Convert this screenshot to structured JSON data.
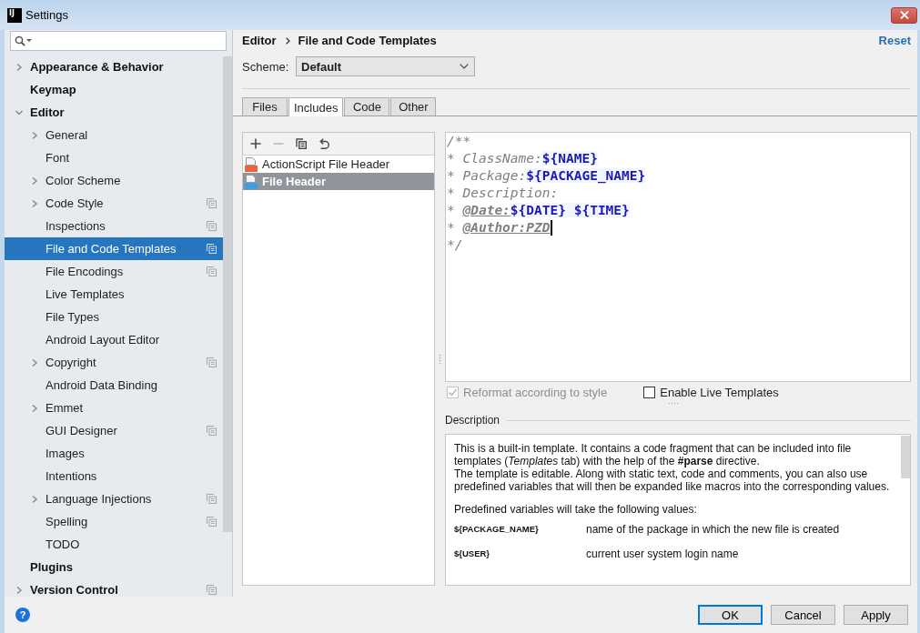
{
  "window": {
    "logo": "IJ",
    "title": "Settings"
  },
  "sidebar": {
    "items": [
      {
        "label": "Appearance & Behavior",
        "expanded": false,
        "selected": false,
        "project_level": false
      },
      {
        "label": "Keymap",
        "selected": false,
        "project_level": false
      },
      {
        "label": "Editor",
        "expanded": true,
        "selected": false,
        "project_level": false,
        "children": [
          {
            "label": "General",
            "expanded": false,
            "selected": false,
            "project_level": false
          },
          {
            "label": "Font",
            "selected": false,
            "project_level": false
          },
          {
            "label": "Color Scheme",
            "expanded": false,
            "selected": false,
            "project_level": false
          },
          {
            "label": "Code Style",
            "expanded": false,
            "selected": false,
            "project_level": true
          },
          {
            "label": "Inspections",
            "selected": false,
            "project_level": true
          },
          {
            "label": "File and Code Templates",
            "selected": true,
            "project_level": true
          },
          {
            "label": "File Encodings",
            "selected": false,
            "project_level": true
          },
          {
            "label": "Live Templates",
            "selected": false,
            "project_level": false
          },
          {
            "label": "File Types",
            "selected": false,
            "project_level": false
          },
          {
            "label": "Android Layout Editor",
            "selected": false,
            "project_level": false
          },
          {
            "label": "Copyright",
            "expanded": false,
            "selected": false,
            "project_level": true
          },
          {
            "label": "Android Data Binding",
            "selected": false,
            "project_level": false
          },
          {
            "label": "Emmet",
            "expanded": false,
            "selected": false,
            "project_level": false
          },
          {
            "label": "GUI Designer",
            "selected": false,
            "project_level": true
          },
          {
            "label": "Images",
            "selected": false,
            "project_level": false
          },
          {
            "label": "Intentions",
            "selected": false,
            "project_level": false
          },
          {
            "label": "Language Injections",
            "expanded": false,
            "selected": false,
            "project_level": true
          },
          {
            "label": "Spelling",
            "selected": false,
            "project_level": true
          },
          {
            "label": "TODO",
            "selected": false,
            "project_level": false
          }
        ]
      },
      {
        "label": "Plugins",
        "selected": false,
        "project_level": false
      },
      {
        "label": "Version Control",
        "expanded": false,
        "selected": false,
        "project_level": true
      }
    ]
  },
  "breadcrumb": [
    "Editor",
    "File and Code Templates"
  ],
  "reset_link": "Reset",
  "scheme": {
    "label": "Scheme:",
    "value": "Default"
  },
  "tabs": [
    {
      "label": "Files",
      "selected": false
    },
    {
      "label": "Includes",
      "selected": true
    },
    {
      "label": "Code",
      "selected": false
    },
    {
      "label": "Other",
      "selected": false
    }
  ],
  "template_list": {
    "toolbar": [
      {
        "kind": "add",
        "disabled": false
      },
      {
        "kind": "remove",
        "disabled": true
      },
      {
        "kind": "copy",
        "disabled": false
      },
      {
        "kind": "reset",
        "disabled": false
      }
    ],
    "items": [
      {
        "kind": "actionscript",
        "label": "ActionScript File Header",
        "selected": false
      },
      {
        "kind": "java",
        "label": "File Header",
        "selected": true
      }
    ]
  },
  "editor": {
    "lines": [
      [
        {
          "kind": "comment",
          "text": "/**"
        }
      ],
      [
        {
          "kind": "comment",
          "text": "* ClassName:"
        },
        {
          "kind": "variable",
          "text": "${NAME}"
        }
      ],
      [
        {
          "kind": "comment",
          "text": "* Package:"
        },
        {
          "kind": "variable",
          "text": "${PACKAGE_NAME}"
        }
      ],
      [
        {
          "kind": "comment",
          "text": "* Description:"
        }
      ],
      [
        {
          "kind": "comment",
          "text": "* "
        },
        {
          "kind": "tag",
          "text": "@Date:"
        },
        {
          "kind": "variable",
          "text": "${DATE} ${TIME}"
        }
      ],
      [
        {
          "kind": "comment",
          "text": "* "
        },
        {
          "kind": "tag",
          "text": "@Author:PZD"
        },
        {
          "kind": "caret"
        }
      ],
      [
        {
          "kind": "comment",
          "text": "*/"
        }
      ]
    ]
  },
  "options": [
    {
      "label": "Reformat according to style",
      "checked": true,
      "disabled": true
    },
    {
      "label": "Enable Live Templates",
      "checked": false,
      "disabled": false
    }
  ],
  "description": {
    "heading": "Description",
    "paragraphs": [
      "This is a built-in template. It contains a code fragment that can be included into file templates (*Templates* tab) with the help of the **#parse** directive.",
      "The template is editable. Along with static text, code and comments, you can also use predefined variables that will then be expanded like macros into the corresponding values."
    ],
    "variables_intro": "Predefined variables will take the following values:",
    "variables": [
      {
        "name": "${PACKAGE_NAME}",
        "description": "name of the package in which the new file is created"
      },
      {
        "name": "${USER}",
        "description": "current user system login name"
      }
    ]
  },
  "help_button": "?",
  "buttons": [
    {
      "label": "OK",
      "default": true
    },
    {
      "label": "Cancel",
      "default": false
    },
    {
      "label": "Apply",
      "default": false
    }
  ]
}
